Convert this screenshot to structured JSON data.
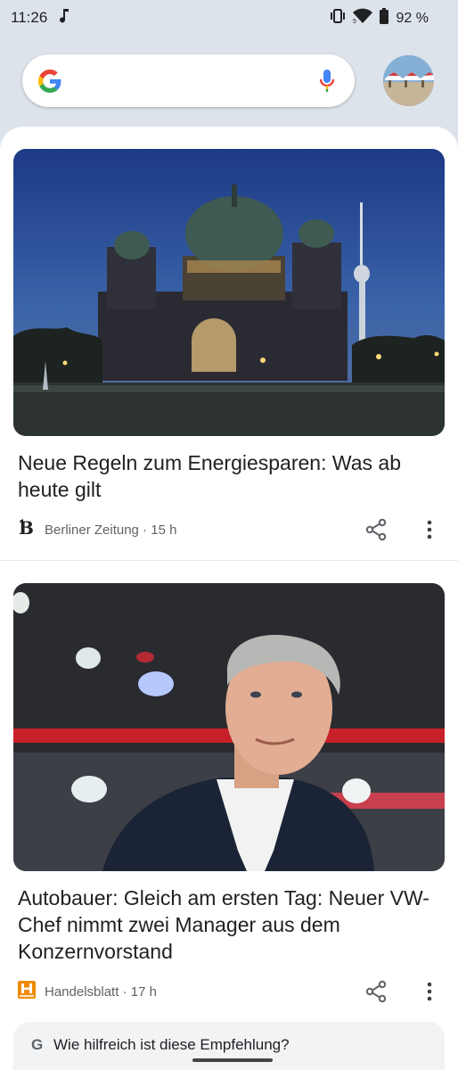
{
  "status_bar": {
    "time": "11:26",
    "battery": "92 %",
    "icons": [
      "music-note-icon",
      "vibrate-icon",
      "wifi-icon",
      "battery-icon"
    ]
  },
  "search": {
    "placeholder": "",
    "icons": [
      "google-g-icon",
      "mic-icon"
    ]
  },
  "feed": {
    "articles": [
      {
        "title": "Neue Regeln zum Energiesparen: Was ab heute gilt",
        "source": "Berliner Zeitung",
        "time": "15 h",
        "image": "berlin-cathedral-night-photo"
      },
      {
        "title": "Autobauer: Gleich am ersten Tag: Neuer VW-Chef nimmt zwei Manager aus dem Konzernvorstand",
        "source": "Handelsblatt",
        "time": "17 h",
        "image": "vw-ceo-portrait-photo"
      }
    ],
    "feedback": {
      "g": "G",
      "question": "Wie hilfreich ist diese Empfehlung?"
    }
  },
  "colors": {
    "background": "#dde3ea",
    "google_blue": "#4285F4",
    "google_red": "#EA4335",
    "google_yellow": "#FBBC05",
    "google_green": "#34A853",
    "handelsblatt_orange": "#f08a00"
  }
}
